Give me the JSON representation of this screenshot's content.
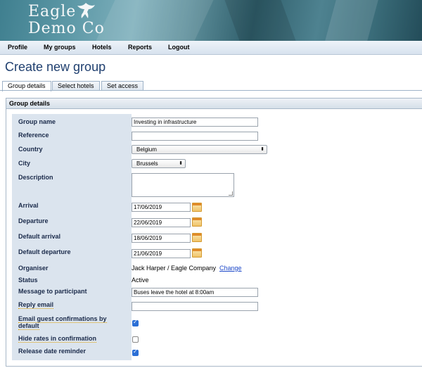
{
  "brand": {
    "line1": "Eagle",
    "line2": "Demo Co"
  },
  "nav": [
    "Profile",
    "My groups",
    "Hotels",
    "Reports",
    "Logout"
  ],
  "page_title": "Create new group",
  "tabs": [
    "Group details",
    "Select hotels",
    "Set access"
  ],
  "panel_title": "Group details",
  "fields": {
    "group_name": {
      "label": "Group name",
      "value": "Investing in infrastructure"
    },
    "reference": {
      "label": "Reference",
      "value": ""
    },
    "country": {
      "label": "Country",
      "value": "Belgium"
    },
    "city": {
      "label": "City",
      "value": "Brussels"
    },
    "description": {
      "label": "Description",
      "value": ""
    },
    "arrival": {
      "label": "Arrival",
      "value": "17/06/2019"
    },
    "departure": {
      "label": "Departure",
      "value": "22/06/2019"
    },
    "default_arrival": {
      "label": "Default arrival",
      "value": "18/06/2019"
    },
    "default_departure": {
      "label": "Default departure",
      "value": "21/06/2019"
    },
    "organiser": {
      "label": "Organiser",
      "value": "Jack Harper / Eagle Company",
      "action": "Change"
    },
    "status": {
      "label": "Status",
      "value": "Active"
    },
    "message": {
      "label": "Message to participant",
      "value": "Buses leave the hotel at 8:00am"
    },
    "reply_email": {
      "label": "Reply email",
      "value": ""
    },
    "email_confirm": {
      "label1": "Email guest confirmations by",
      "label2": "default",
      "checked": true
    },
    "hide_rates": {
      "label": "Hide rates in confirmation",
      "checked": false
    },
    "release_reminder": {
      "label": "Release date reminder",
      "checked": true
    }
  }
}
